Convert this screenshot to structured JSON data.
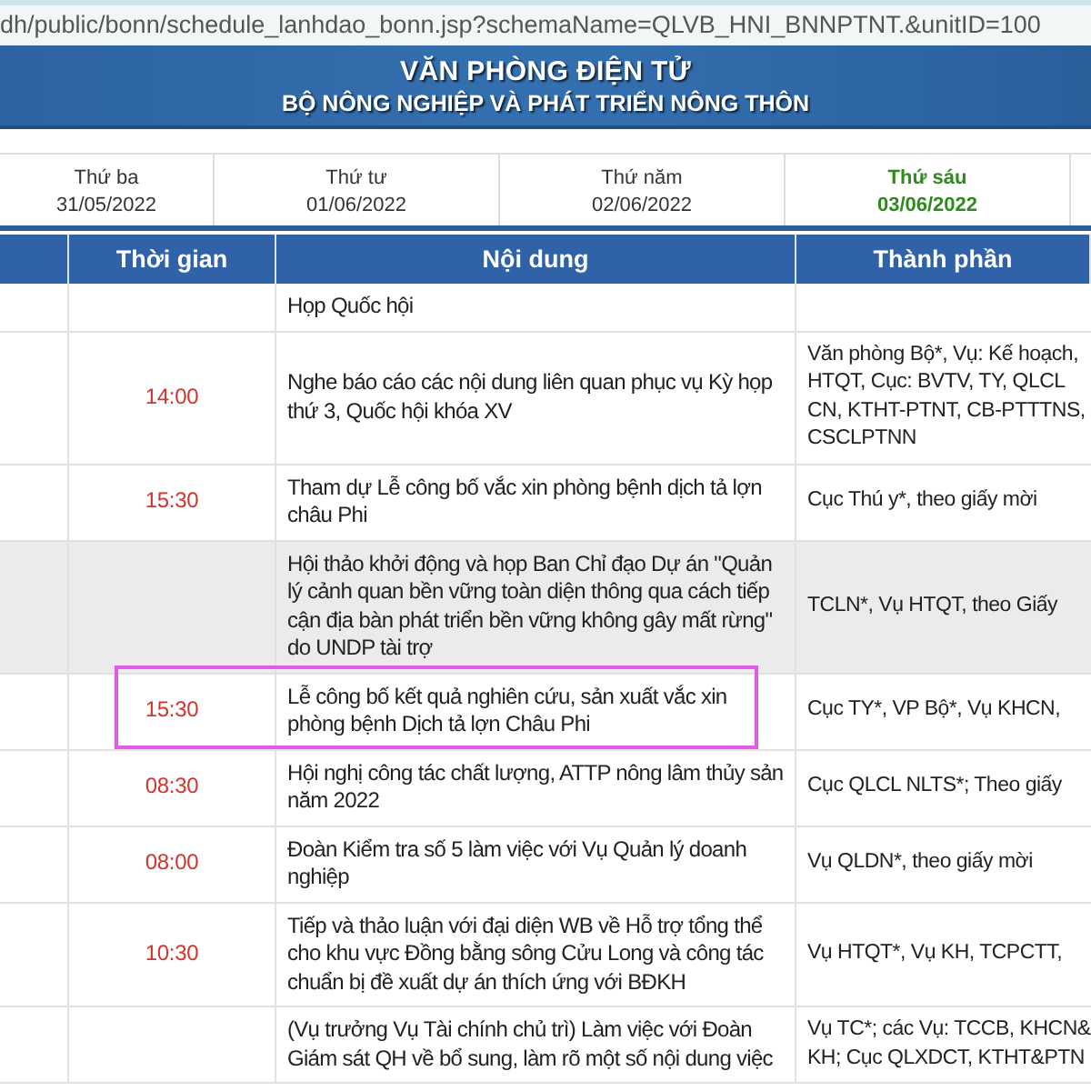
{
  "address_bar": {
    "url": "dh/public/bonn/schedule_lanhdao_bonn.jsp?schemaName=QLVB_HNI_BNNPTNT.&unitID=100"
  },
  "banner": {
    "title": "VĂN PHÒNG ĐIỆN TỬ",
    "subtitle": "BỘ NÔNG NGHIỆP VÀ PHÁT TRIỂN NÔNG THÔN"
  },
  "day_tabs": [
    {
      "day": "Thứ ba",
      "date": "31/05/2022",
      "selected": false
    },
    {
      "day": "Thứ tư",
      "date": "01/06/2022",
      "selected": false
    },
    {
      "day": "Thứ năm",
      "date": "02/06/2022",
      "selected": false
    },
    {
      "day": "Thứ sáu",
      "date": "03/06/2022",
      "selected": true
    }
  ],
  "table": {
    "columns": [
      "Thời gian",
      "Nội dung",
      "Thành phần"
    ],
    "rows": [
      {
        "time": "",
        "content": "Họp Quốc hội",
        "participants": [],
        "shaded": false,
        "highlighted": false
      },
      {
        "time": "14:00",
        "content": "Nghe báo cáo các nội dung liên quan phục vụ Kỳ họp thứ 3, Quốc hội khóa XV",
        "participants": [
          "Văn phòng Bộ*, Vụ: Kế hoạch,",
          "HTQT, Cục: BVTV, TY, QLCL",
          "CN, KTHT-PTNT, CB-PTTTNS,",
          "CSCLPTNN"
        ],
        "shaded": false,
        "highlighted": false
      },
      {
        "time": "15:30",
        "content": "Tham dự Lễ công bố vắc xin phòng bệnh dịch tả lợn châu Phi",
        "participants": [
          "Cục Thú y*, theo giấy mời"
        ],
        "shaded": false,
        "highlighted": false
      },
      {
        "time": "",
        "content": "Hội thảo khởi động và họp Ban Chỉ đạo Dự án \"Quản lý cảnh quan bền vững toàn diện thông qua cách tiếp cận địa bàn phát triển bền vững không gây mất rừng\" do UNDP tài trợ",
        "participants": [
          "TCLN*, Vụ HTQT, theo Giấy"
        ],
        "shaded": true,
        "highlighted": false
      },
      {
        "time": "15:30",
        "content": "Lễ công bố kết quả nghiên cứu, sản xuất vắc xin phòng bệnh Dịch tả lợn Châu Phi",
        "participants": [
          "Cục TY*, VP Bộ*, Vụ KHCN,"
        ],
        "shaded": false,
        "highlighted": true
      },
      {
        "time": "08:30",
        "content": "Hội nghị công tác chất lượng, ATTP nông lâm thủy sản năm 2022",
        "participants": [
          "Cục QLCL NLTS*; Theo giấy"
        ],
        "shaded": false,
        "highlighted": false
      },
      {
        "time": "08:00",
        "content": "Đoàn Kiểm tra số 5 làm việc với Vụ Quản lý doanh nghiệp",
        "participants": [
          "Vụ QLDN*, theo giấy mời"
        ],
        "shaded": false,
        "highlighted": false
      },
      {
        "time": "10:30",
        "content": "Tiếp và thảo luận với đại diện WB về Hỗ trợ tổng thể cho khu vực Đồng bằng sông Cửu Long và công tác chuẩn bị đề xuất dự án thích ứng với BĐKH",
        "participants": [
          "Vụ HTQT*, Vụ KH, TCPCTT,"
        ],
        "shaded": false,
        "highlighted": false
      },
      {
        "time": "",
        "content": "(Vụ trưởng Vụ Tài chính chủ trì) Làm việc với Đoàn Giám sát QH về bổ sung, làm rõ một số nội dung việc",
        "participants": [
          "Vụ TC*; các Vụ: TCCB, KHCN&",
          "KH; Cục QLXDCT, KTHT&PTN"
        ],
        "shaded": false,
        "highlighted": false
      }
    ]
  }
}
